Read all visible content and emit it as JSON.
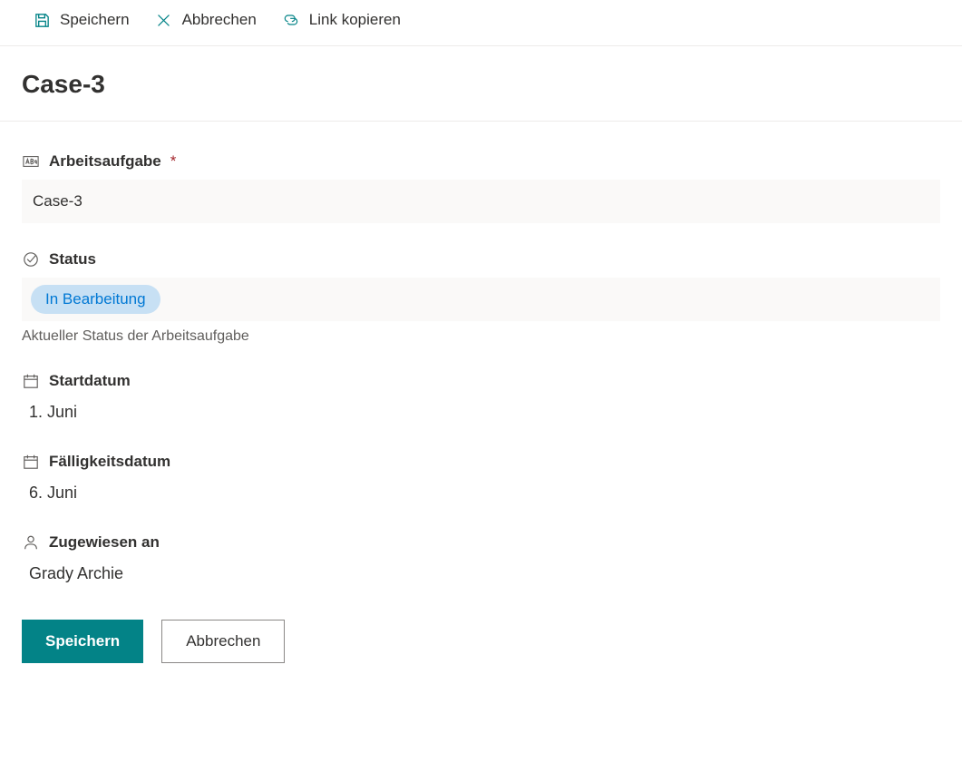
{
  "toolbar": {
    "save": "Speichern",
    "cancel": "Abbrechen",
    "copy_link": "Link kopieren"
  },
  "page": {
    "title": "Case-3"
  },
  "fields": {
    "work_item": {
      "label": "Arbeitsaufgabe",
      "required_mark": "*",
      "value": "Case-3"
    },
    "status": {
      "label": "Status",
      "value": "In Bearbeitung",
      "helper": "Aktueller Status der Arbeitsaufgabe"
    },
    "start_date": {
      "label": "Startdatum",
      "value": "1. Juni"
    },
    "due_date": {
      "label": "Fälligkeitsdatum",
      "value": "6. Juni"
    },
    "assigned_to": {
      "label": "Zugewiesen an",
      "value": "Grady Archie"
    }
  },
  "buttons": {
    "save": "Speichern",
    "cancel": "Abbrechen"
  }
}
